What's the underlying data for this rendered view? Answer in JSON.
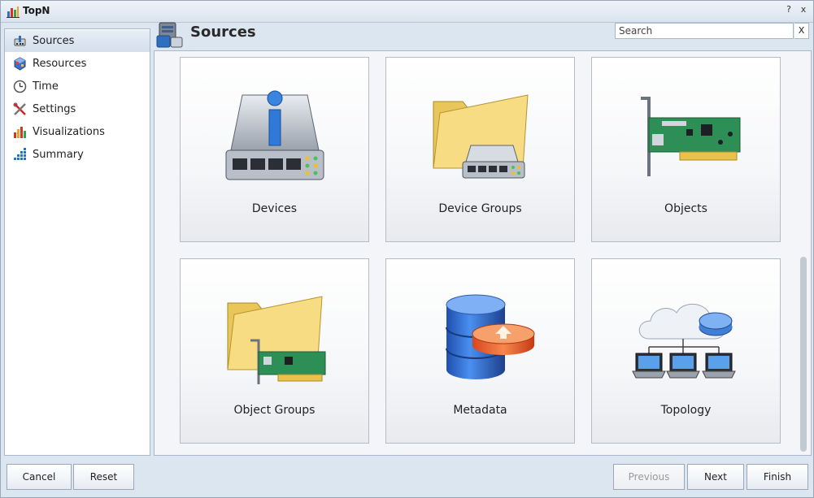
{
  "window": {
    "title": "TopN",
    "help": "?",
    "close": "x"
  },
  "sidebar": {
    "items": [
      {
        "label": "Sources",
        "icon": "sources-icon",
        "active": true
      },
      {
        "label": "Resources",
        "icon": "resources-icon"
      },
      {
        "label": "Time",
        "icon": "clock-icon"
      },
      {
        "label": "Settings",
        "icon": "tools-icon"
      },
      {
        "label": "Visualizations",
        "icon": "chart-icon"
      },
      {
        "label": "Summary",
        "icon": "summary-icon"
      }
    ]
  },
  "header": {
    "title": "Sources",
    "search_placeholder": "Search",
    "search_clear": "X"
  },
  "tiles": [
    {
      "label": "Devices",
      "icon": "network-device-icon"
    },
    {
      "label": "Device Groups",
      "icon": "device-folder-icon"
    },
    {
      "label": "Objects",
      "icon": "network-card-icon"
    },
    {
      "label": "Object Groups",
      "icon": "object-folder-icon"
    },
    {
      "label": "Metadata",
      "icon": "database-icon"
    },
    {
      "label": "Topology",
      "icon": "cloud-network-icon"
    }
  ],
  "footer": {
    "cancel": "Cancel",
    "reset": "Reset",
    "previous": "Previous",
    "next": "Next",
    "finish": "Finish"
  }
}
